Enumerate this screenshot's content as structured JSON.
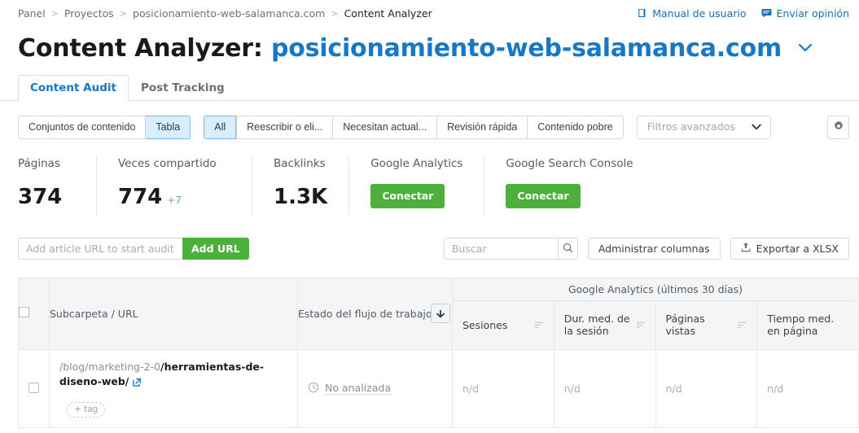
{
  "breadcrumb": {
    "items": [
      {
        "label": "Panel"
      },
      {
        "label": "Proyectos"
      },
      {
        "label": "posicionamiento-web-salamanca.com"
      },
      {
        "label": "Content Analyzer"
      }
    ],
    "separator": ">"
  },
  "toplinks": [
    {
      "label": "Manual de usuario",
      "icon": "book-icon"
    },
    {
      "label": "Enviar opinión",
      "icon": "feedback-icon"
    }
  ],
  "header": {
    "title_prefix": "Content Analyzer:",
    "domain": "posicionamiento-web-salamanca.com"
  },
  "tabs": [
    {
      "label": "Content Audit",
      "active": true
    },
    {
      "label": "Post Tracking",
      "active": false
    }
  ],
  "filters": {
    "view_group": [
      {
        "label": "Conjuntos de contenido",
        "selected": false
      },
      {
        "label": "Tabla",
        "selected": true
      }
    ],
    "segment_group": [
      {
        "label": "All",
        "selected": true
      },
      {
        "label": "Reescribir o eli...",
        "selected": false
      },
      {
        "label": "Necesitan actual...",
        "selected": false
      },
      {
        "label": "Revisión rápida",
        "selected": false
      },
      {
        "label": "Contenido pobre",
        "selected": false
      }
    ],
    "advanced_label": "Filtros avanzados",
    "settings_icon": "gear-icon"
  },
  "metrics": [
    {
      "label": "Páginas",
      "value": "374",
      "delta": "",
      "button": ""
    },
    {
      "label": "Veces compartido",
      "value": "774",
      "delta": "+7",
      "button": ""
    },
    {
      "label": "Backlinks",
      "value": "1.3K",
      "delta": "",
      "button": ""
    },
    {
      "label": "Google Analytics",
      "value": "",
      "delta": "",
      "button": "Conectar"
    },
    {
      "label": "Google Search Console",
      "value": "",
      "delta": "",
      "button": "Conectar"
    }
  ],
  "actions": {
    "url_input_placeholder": "Add article URL to start audit",
    "url_input_value": "",
    "add_url_label": "Add URL",
    "search_placeholder": "Buscar",
    "search_value": "",
    "search_icon": "search-icon",
    "manage_columns_label": "Administrar columnas",
    "export_label": "Exportar a XLSX",
    "export_icon": "upload-icon"
  },
  "table": {
    "group_header": "Google Analytics (últimos 30 días)",
    "columns": {
      "url": "Subcarpeta / URL",
      "state": "Estado del flujo de trabajo",
      "sessions": "Sesiones",
      "duration": "Dur. med. de la sesión",
      "pageviews": "Páginas vistas",
      "time_on_page": "Tiempo med. en página"
    },
    "rows": [
      {
        "url_prefix": "/blog/marketing-2-0",
        "url_leaf": "/herramientas-de-diseno-web/",
        "external_icon": "external-link-icon",
        "tag_label": "+ tag",
        "state": "No analizada",
        "state_icon": "clock-icon",
        "sessions": "n/d",
        "duration": "n/d",
        "pageviews": "n/d",
        "time_on_page": "n/d"
      }
    ]
  },
  "colors": {
    "accent_blue": "#1878c8",
    "green": "#4eb03c",
    "selected_blue_bg": "#d9eefb",
    "muted": "#8a9096"
  }
}
